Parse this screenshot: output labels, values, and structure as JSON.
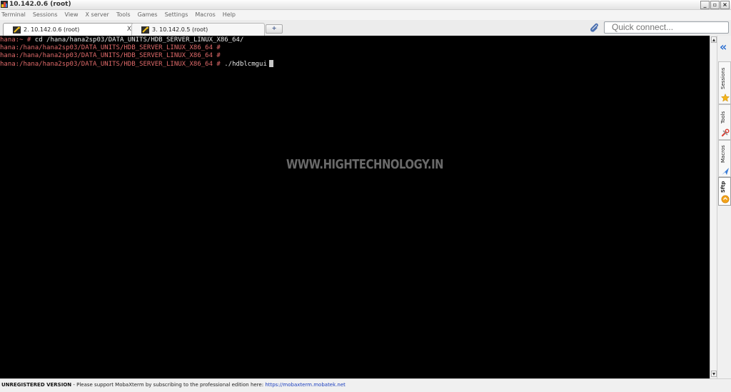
{
  "window": {
    "title": "10.142.0.6 (root)"
  },
  "menubar": [
    "Terminal",
    "Sessions",
    "View",
    "X server",
    "Tools",
    "Games",
    "Settings",
    "Macros",
    "Help"
  ],
  "tabs": [
    {
      "label": "2. 10.142.0.6 (root)",
      "active": true,
      "close": "X"
    },
    {
      "label": "3. 10.142.0.5 (root)",
      "active": false
    }
  ],
  "new_tab_glyph": "+",
  "quick_connect": {
    "placeholder": "Quick connect..."
  },
  "terminal": {
    "lines": [
      {
        "prompt": "hana:~ # ",
        "command": "cd /hana/hana2sp03/DATA_UNITS/HDB_SERVER_LINUX_X86_64/",
        "prompt_color": "#e06a6a"
      },
      {
        "prompt": "hana:/hana/hana2sp03/DATA_UNITS/HDB_SERVER_LINUX_X86_64 #",
        "command": ""
      },
      {
        "prompt": "hana:/hana/hana2sp03/DATA_UNITS/HDB_SERVER_LINUX_X86_64 #",
        "command": ""
      },
      {
        "prompt": "hana:/hana/hana2sp03/DATA_UNITS/HDB_SERVER_LINUX_X86_64 # ",
        "command": "./hdblcmgui"
      }
    ],
    "watermark": "WWW.HIGHTECHNOLOGY.IN"
  },
  "sidebar": {
    "collapse_icon": "«",
    "tabs": [
      {
        "label": "Sessions",
        "icon": "star-icon",
        "icon_color": "#f3b51b"
      },
      {
        "label": "Tools",
        "icon": "tools-icon",
        "icon_color": "#d9453b"
      },
      {
        "label": "Macros",
        "icon": "macro-icon",
        "icon_color": "#3b7dd8"
      },
      {
        "label": "Sftp",
        "icon": "sftp-icon",
        "icon_color": "#f2a21a",
        "active": true
      }
    ]
  },
  "status": {
    "unregistered": "UNREGISTERED VERSION",
    "message": " -  Please support MobaXterm by subscribing to the professional edition here: ",
    "link": "https://mobaxterm.mobatek.net"
  },
  "colors": {
    "terminal_bg": "#000000",
    "prompt": "#e06a6a",
    "accent": "#2c6fd1"
  }
}
